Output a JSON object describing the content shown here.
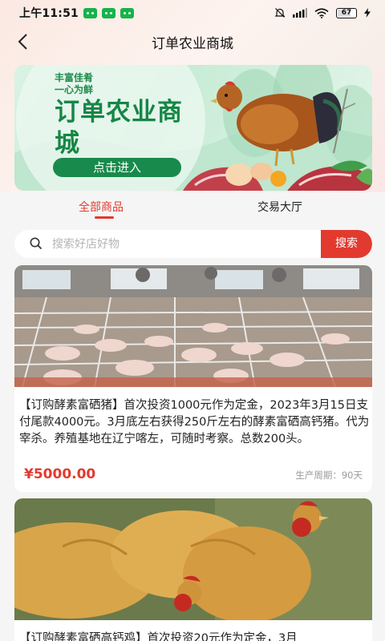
{
  "status_bar": {
    "time": "上午11:51",
    "battery": "67"
  },
  "header": {
    "title": "订单农业商城"
  },
  "banner": {
    "slogan_line1": "丰富佳肴",
    "slogan_line2": "一心为鲜",
    "title": "订单农业商城",
    "button_label": "点击进入"
  },
  "tabs": [
    {
      "label": "全部商品",
      "active": true
    },
    {
      "label": "交易大厅",
      "active": false
    }
  ],
  "search": {
    "placeholder": "搜索好店好物",
    "button_label": "搜索"
  },
  "products": [
    {
      "description": "【订购酵素富硒猪】首次投资1000元作为定金，2023年3月15日支付尾款4000元。3月底左右获得250斤左右的酵素富硒高钙猪。代为宰杀。养殖基地在辽宁喀左，可随时考察。总数200头。",
      "price": "¥5000.00",
      "period": "生产周期：90天"
    },
    {
      "description": "【订购酵素富硒高钙鸡】首次投资20元作为定金，3月"
    }
  ],
  "colors": {
    "accent": "#e23a2f",
    "banner_green": "#168646"
  }
}
